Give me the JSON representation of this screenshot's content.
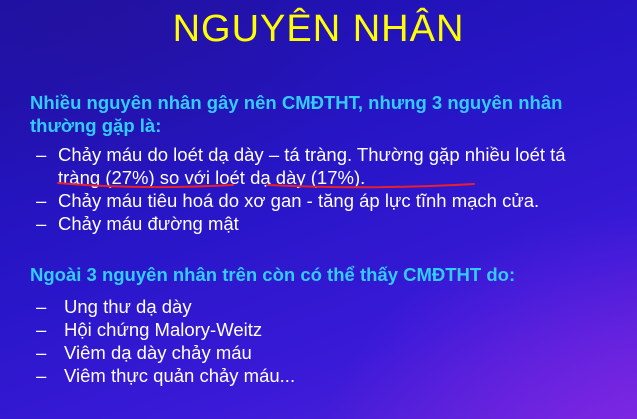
{
  "slide": {
    "title": "NGUYÊN NHÂN",
    "intro": "Nhiều nguyên nhân gây nên CMĐTHT, nhưng 3 nguyên nhân thường gặp là:",
    "main_causes": [
      "Chảy máu do loét dạ dày – tá tràng. Thường gặp nhiều loét tá tràng (27%) so với loét dạ dày (17%).",
      "Chảy máu tiêu hoá do xơ gan - tăng áp lực tĩnh mạch cửa.",
      "Chảy máu đường mật"
    ],
    "other_intro": "Ngoài 3 nguyên nhân trên còn có thể thấy CMĐTHT do:",
    "other_causes": [
      "Ung thư dạ dày",
      "Hội chứng Malory-Weitz",
      "Viêm dạ dày chảy máu",
      "Viêm thực quản chảy máu..."
    ],
    "bullet": "–"
  },
  "colors": {
    "title": "#ffff00",
    "heading": "#33ccff",
    "body_text": "#ffffff",
    "annotation": "#e8202a"
  }
}
